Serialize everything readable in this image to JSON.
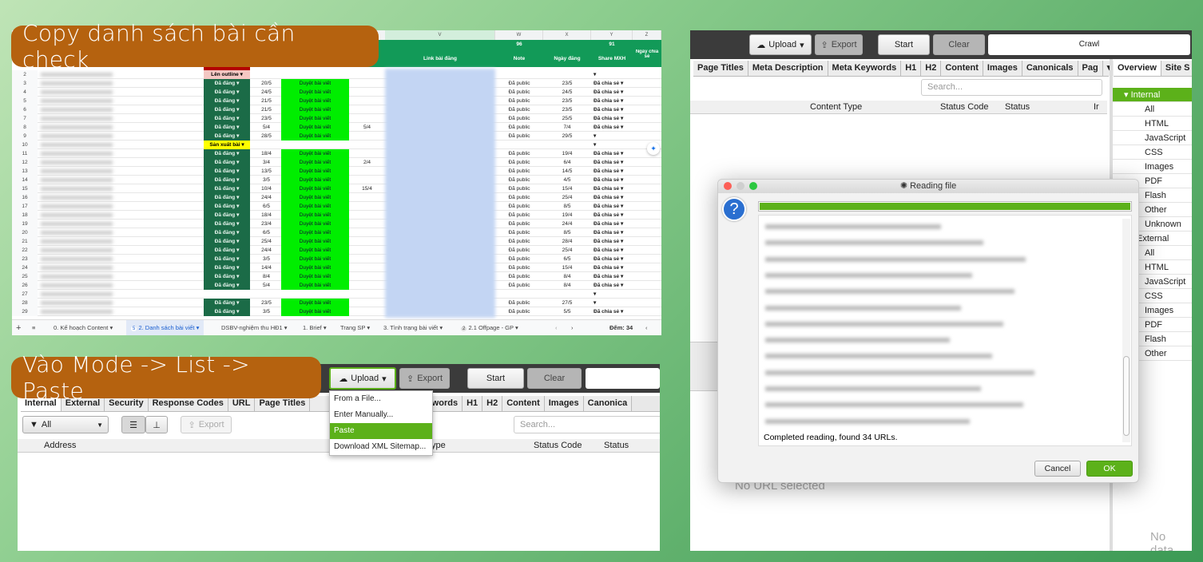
{
  "callouts": {
    "step1": "Copy danh sách bài cần check",
    "step2": "Vào Mode -> List -> Paste"
  },
  "sheet": {
    "col_letters": [
      "V",
      "W",
      "X",
      "Y",
      "Z"
    ],
    "header": {
      "link": "Link bài đăng",
      "note_count": "96",
      "note": "Note",
      "date": "Ngày đăng",
      "share_count": "91",
      "share": "Share MXH",
      "share_date": "Ngày chia sẻ"
    },
    "rows": [
      [
        "2",
        "Lên outline",
        "",
        "",
        "",
        "",
        "",
        ""
      ],
      [
        "3",
        "Đã đăng",
        "20/5",
        "Duyệt bài viết",
        "",
        "Đã public",
        "23/5",
        "Đã chia sẻ"
      ],
      [
        "4",
        "Đã đăng",
        "24/5",
        "Duyệt bài viết",
        "",
        "Đã public",
        "24/5",
        "Đã chia sẻ"
      ],
      [
        "5",
        "Đã đăng",
        "21/5",
        "Duyệt bài viết",
        "",
        "Đã public",
        "23/5",
        "Đã chia sẻ"
      ],
      [
        "6",
        "Đã đăng",
        "21/5",
        "Duyệt bài viết",
        "",
        "Đã public",
        "23/5",
        "Đã chia sẻ"
      ],
      [
        "7",
        "Đã đăng",
        "23/5",
        "Duyệt bài viết",
        "",
        "Đã public",
        "25/5",
        "Đã chia sẻ"
      ],
      [
        "8",
        "Đã đăng",
        "5/4",
        "Duyệt bài viết",
        "5/4",
        "Đã public",
        "7/4",
        "Đã chia sẻ"
      ],
      [
        "9",
        "Đã đăng",
        "28/5",
        "Duyệt bài viết",
        "",
        "Đã public",
        "29/5",
        ""
      ],
      [
        "10",
        "Sản xuất bài",
        "",
        "",
        "",
        "",
        "",
        ""
      ],
      [
        "11",
        "Đã đăng",
        "18/4",
        "Duyệt bài viết",
        "",
        "Đã public",
        "19/4",
        "Đã chia sẻ"
      ],
      [
        "12",
        "Đã đăng",
        "3/4",
        "Duyệt bài viết",
        "2/4",
        "Đã public",
        "6/4",
        "Đã chia sẻ"
      ],
      [
        "13",
        "Đã đăng",
        "13/5",
        "Duyệt bài viết",
        "",
        "Đã public",
        "14/5",
        "Đã chia sẻ"
      ],
      [
        "14",
        "Đã đăng",
        "3/5",
        "Duyệt bài viết",
        "",
        "Đã public",
        "4/5",
        "Đã chia sẻ"
      ],
      [
        "15",
        "Đã đăng",
        "10/4",
        "Duyệt bài viết",
        "15/4",
        "Đã public",
        "15/4",
        "Đã chia sẻ"
      ],
      [
        "16",
        "Đã đăng",
        "24/4",
        "Duyệt bài viết",
        "",
        "Đã public",
        "25/4",
        "Đã chia sẻ"
      ],
      [
        "17",
        "Đã đăng",
        "6/5",
        "Duyệt bài viết",
        "",
        "Đã public",
        "8/5",
        "Đã chia sẻ"
      ],
      [
        "18",
        "Đã đăng",
        "18/4",
        "Duyệt bài viết",
        "",
        "Đã public",
        "19/4",
        "Đã chia sẻ"
      ],
      [
        "19",
        "Đã đăng",
        "23/4",
        "Duyệt bài viết",
        "",
        "Đã public",
        "24/4",
        "Đã chia sẻ"
      ],
      [
        "20",
        "Đã đăng",
        "6/5",
        "Duyệt bài viết",
        "",
        "Đã public",
        "8/5",
        "Đã chia sẻ"
      ],
      [
        "21",
        "Đã đăng",
        "25/4",
        "Duyệt bài viết",
        "",
        "Đã public",
        "28/4",
        "Đã chia sẻ"
      ],
      [
        "22",
        "Đã đăng",
        "24/4",
        "Duyệt bài viết",
        "",
        "Đã public",
        "25/4",
        "Đã chia sẻ"
      ],
      [
        "23",
        "Đã đăng",
        "3/5",
        "Duyệt bài viết",
        "",
        "Đã public",
        "6/5",
        "Đã chia sẻ"
      ],
      [
        "24",
        "Đã đăng",
        "14/4",
        "Duyệt bài viết",
        "",
        "Đã public",
        "15/4",
        "Đã chia sẻ"
      ],
      [
        "25",
        "Đã đăng",
        "8/4",
        "Duyệt bài viết",
        "",
        "Đã public",
        "8/4",
        "Đã chia sẻ"
      ],
      [
        "26",
        "Đã đăng",
        "5/4",
        "Duyệt bài viết",
        "",
        "Đã public",
        "8/4",
        "Đã chia sẻ"
      ],
      [
        "27",
        "",
        "",
        "",
        "",
        "",
        "",
        ""
      ],
      [
        "28",
        "Đã đăng",
        "23/5",
        "Duyệt bài viết",
        "",
        "Đã public",
        "27/5",
        ""
      ],
      [
        "29",
        "Đã đăng",
        "3/5",
        "Duyệt bài viết",
        "",
        "Đã public",
        "5/5",
        "Đã chia sẻ"
      ]
    ],
    "tabs": {
      "add": "+",
      "all": "≡",
      "t0": "0. Kế hoạch Content",
      "t1_badge": "5",
      "t1": "2. Danh sách bài viết",
      "t2": "DSBV-nghiệm thu HĐ1",
      "t3": "1. Brief",
      "t4": "Trang SP",
      "t5": "3. Tình trạng bài viết",
      "t6_badge": "2",
      "t6": "2.1 Offpage - GP",
      "count": "Đếm: 34"
    },
    "colors": {
      "published": "#1b6b47",
      "approved": "#00ee00",
      "header": "#129a58"
    }
  },
  "sf_list": {
    "upload": "Upload",
    "export": "Export",
    "start": "Start",
    "clear": "Clear",
    "tabs": [
      "Internal",
      "External",
      "Security",
      "Response Codes",
      "URL",
      "Page Titles"
    ],
    "tabs_right": [
      "a Keywords",
      "H1",
      "H2",
      "Content",
      "Images",
      "Canonica"
    ],
    "filter": "All",
    "export2": "Export",
    "search_placeholder": "Search...",
    "columns": {
      "address": "Address",
      "type": "ype",
      "status_code": "Status Code",
      "status": "Status"
    },
    "menu": [
      "From a File...",
      "Enter Manually...",
      "Paste",
      "Download XML Sitemap..."
    ]
  },
  "sf_main": {
    "upload": "Upload",
    "export": "Export",
    "start": "Start",
    "clear": "Clear",
    "crawl": "Crawl",
    "tabs": [
      "Page Titles",
      "Meta Description",
      "Meta Keywords",
      "H1",
      "H2",
      "Content",
      "Images",
      "Canonicals",
      "Pag"
    ],
    "right_tabs": [
      "Overview",
      "Site S"
    ],
    "search_placeholder": "Search...",
    "columns": {
      "content_type": "Content Type",
      "status_code": "Status Code",
      "status": "Status",
      "more": "Ir"
    },
    "tree": {
      "internal": "Internal",
      "internal_items": [
        "All",
        "HTML",
        "JavaScript",
        "CSS",
        "Images",
        "PDF",
        "Flash",
        "Other",
        "Unknown"
      ],
      "external": "External",
      "external_items": [
        "All",
        "HTML",
        "JavaScript",
        "CSS",
        "Images",
        "PDF",
        "Flash",
        "Other"
      ]
    },
    "no_url": "No URL selected",
    "no_data": "No data",
    "dialog": {
      "title": "Reading file",
      "progress": 100,
      "status": "Completed reading, found 34 URLs.",
      "cancel": "Cancel",
      "ok": "OK"
    },
    "accent": "#5cb11a"
  }
}
